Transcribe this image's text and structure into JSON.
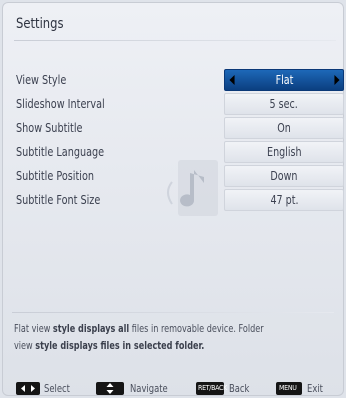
{
  "title": "Settings",
  "settings": [
    {
      "label": "View Style",
      "value": "Flat",
      "selected": true
    },
    {
      "label": "Slideshow Interval",
      "value": "5 sec."
    },
    {
      "label": "Show Subtitle",
      "value": "On"
    },
    {
      "label": "Subtitle Language",
      "value": "English"
    },
    {
      "label": "Subtitle Position",
      "value": "Down"
    },
    {
      "label": "Subtitle Font Size",
      "value": "47 pt."
    }
  ],
  "description": {
    "parts": [
      {
        "text": "Flat view ",
        "bold": false
      },
      {
        "text": "style displays all",
        "bold": true
      },
      {
        "text": " files in removable device. Folder view ",
        "bold": false
      },
      {
        "text": "style displays",
        "bold": true
      },
      {
        "text": " files in selected folder.",
        "bold": true
      }
    ]
  },
  "footer": {
    "select_label": "Select",
    "navigate_label": "Navigate",
    "back_key": "RET/BACK",
    "back_label": "Back",
    "exit_key": "MENU",
    "exit_label": "Exit"
  },
  "colors": {
    "selected_value_bg": "#0b3f80",
    "panel_bg": "#e6e9ef",
    "text": "#3c4150"
  },
  "icons": {
    "watermark": "music-note-icon",
    "footer_select": "left-right-arrows-icon",
    "footer_navigate": "up-down-arrows-icon"
  }
}
